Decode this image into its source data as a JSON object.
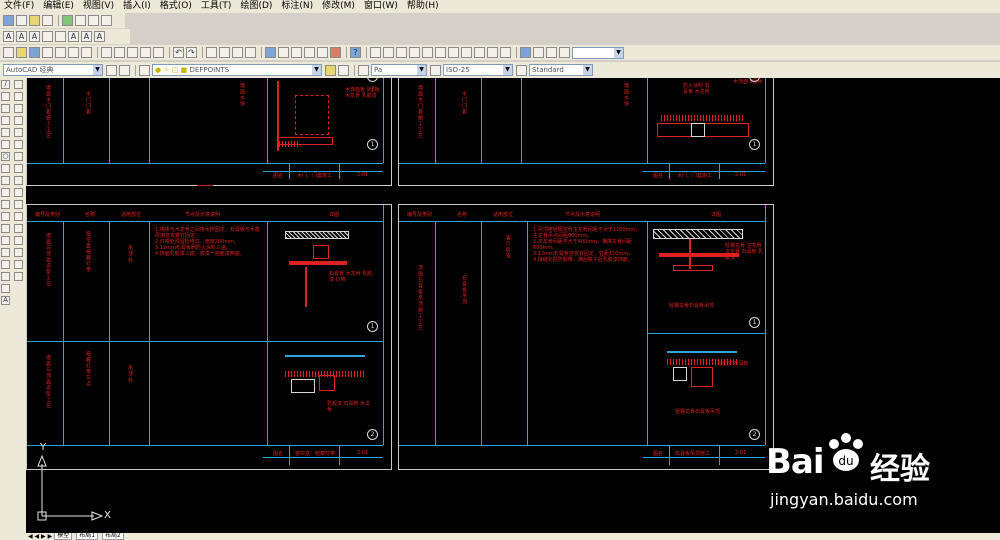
{
  "menu": [
    "文件(F)",
    "编辑(E)",
    "视图(V)",
    "插入(I)",
    "格式(O)",
    "工具(T)",
    "绘图(D)",
    "标注(N)",
    "修改(M)",
    "窗口(W)",
    "帮助(H)"
  ],
  "combos": {
    "workspace": "AutoCAD 经典",
    "layer": "DEFPOINTS",
    "linetype": "Pa",
    "dimstyle": "ISO-25",
    "textstyle": "Standard"
  },
  "sheets": {
    "top_left_title": "木门、门套施工",
    "top_right_title": "木门、门套施工",
    "bottom_left_title": "窗帘盒、暗藏灯带",
    "bottom_right_title": "石膏板吊顶施工",
    "header_cols": [
      "编号及类别",
      "名称",
      "适用部位",
      "节点及示意说明",
      "详图"
    ],
    "mark_label": "图名",
    "page_no": "2-01"
  },
  "ucs": {
    "x": "X",
    "y": "Y"
  },
  "tabs": [
    "模型",
    "布局1",
    "布局2"
  ],
  "watermark": {
    "brand": "Bai",
    "brand2": "du",
    "cn": "经验",
    "url": "jingyan.baidu.com"
  }
}
